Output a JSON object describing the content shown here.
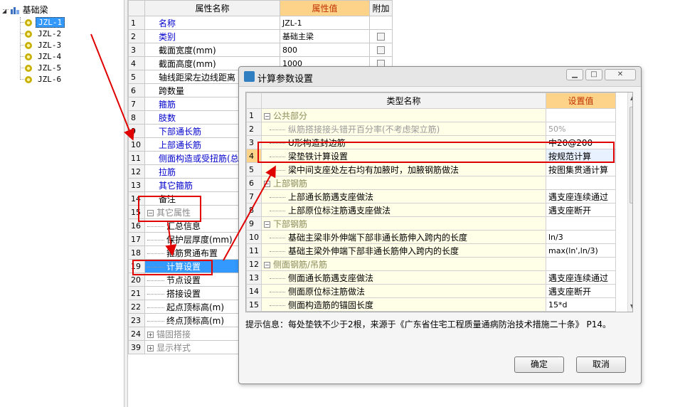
{
  "tree": {
    "root_label": "基础梁",
    "items": [
      {
        "label": "JZL-1",
        "selected": true
      },
      {
        "label": "JZL-2",
        "selected": false
      },
      {
        "label": "JZL-3",
        "selected": false
      },
      {
        "label": "JZL-4",
        "selected": false
      },
      {
        "label": "JZL-5",
        "selected": false
      },
      {
        "label": "JZL-6",
        "selected": false
      }
    ]
  },
  "props": {
    "headers": {
      "name": "属性名称",
      "value": "属性值",
      "extra": "附加"
    },
    "rows": [
      {
        "num": "1",
        "name": "名称",
        "value": "JZL-1",
        "style": "blue",
        "check": false
      },
      {
        "num": "2",
        "name": "类别",
        "value": "基础主梁",
        "style": "blue",
        "check": true
      },
      {
        "num": "3",
        "name": "截面宽度(mm)",
        "value": "800",
        "style": "",
        "check": true
      },
      {
        "num": "4",
        "name": "截面高度(mm)",
        "value": "1000",
        "style": "",
        "check": true
      },
      {
        "num": "5",
        "name": "轴线距梁左边线距离",
        "value": "",
        "style": "",
        "check": false
      },
      {
        "num": "6",
        "name": "跨数量",
        "value": "",
        "style": "",
        "check": false
      },
      {
        "num": "7",
        "name": "箍筋",
        "value": "",
        "style": "blue",
        "check": false
      },
      {
        "num": "8",
        "name": "肢数",
        "value": "",
        "style": "blue",
        "check": false
      },
      {
        "num": "9",
        "name": "下部通长筋",
        "value": "",
        "style": "blue",
        "check": false
      },
      {
        "num": "10",
        "name": "上部通长筋",
        "value": "",
        "style": "blue",
        "check": false
      },
      {
        "num": "11",
        "name": "侧面构造或受扭筋(总",
        "value": "",
        "style": "blue",
        "check": false
      },
      {
        "num": "12",
        "name": "拉筋",
        "value": "",
        "style": "blue",
        "check": false
      },
      {
        "num": "13",
        "name": "其它箍筋",
        "value": "",
        "style": "blue",
        "check": false
      },
      {
        "num": "14",
        "name": "备注",
        "value": "",
        "style": "",
        "check": false
      },
      {
        "num": "15",
        "name": "其它属性",
        "value": "",
        "style": "gray",
        "group": "−",
        "check": false
      },
      {
        "num": "16",
        "name": "汇总信息",
        "value": "",
        "style": "",
        "child": true,
        "check": false
      },
      {
        "num": "17",
        "name": "保护层厚度(mm)",
        "value": "",
        "style": "",
        "child": true,
        "check": false
      },
      {
        "num": "18",
        "name": "箍筋贯通布置",
        "value": "",
        "style": "",
        "child": true,
        "check": false
      },
      {
        "num": "19",
        "name": "计算设置",
        "value": "",
        "style": "",
        "child": true,
        "selected": true,
        "check": false
      },
      {
        "num": "20",
        "name": "节点设置",
        "value": "",
        "style": "",
        "child": true,
        "check": false
      },
      {
        "num": "21",
        "name": "搭接设置",
        "value": "",
        "style": "",
        "child": true,
        "check": false
      },
      {
        "num": "22",
        "name": "起点顶标高(m)",
        "value": "",
        "style": "",
        "child": true,
        "check": false
      },
      {
        "num": "23",
        "name": "终点顶标高(m)",
        "value": "",
        "style": "",
        "child": true,
        "check": false
      },
      {
        "num": "24",
        "name": "锚固搭接",
        "value": "",
        "style": "gray",
        "group": "+",
        "check": false
      },
      {
        "num": "39",
        "name": "显示样式",
        "value": "",
        "style": "gray",
        "group": "+",
        "check": false
      }
    ]
  },
  "dialog": {
    "title": "计算参数设置",
    "headers": {
      "name": "类型名称",
      "value": "设置值"
    },
    "rows": [
      {
        "num": "1",
        "name": "公共部分",
        "value": "",
        "kind": "group"
      },
      {
        "num": "2",
        "name": "纵筋搭接接头错开百分率(不考虑架立筋)",
        "value": "50%",
        "kind": "dim"
      },
      {
        "num": "3",
        "name": "U形构造封边筋",
        "value": "中20@200",
        "kind": "item"
      },
      {
        "num": "4",
        "name": "梁垫铁计算设置",
        "value": "按规范计算",
        "kind": "item",
        "selected": true
      },
      {
        "num": "5",
        "name": "梁中间支座处左右均有加腋时，加腋钢筋做法",
        "value": "按图集贯通计算",
        "kind": "item"
      },
      {
        "num": "6",
        "name": "上部钢筋",
        "value": "",
        "kind": "group"
      },
      {
        "num": "7",
        "name": "上部通长筋遇支座做法",
        "value": "遇支座连续通过",
        "kind": "item"
      },
      {
        "num": "8",
        "name": "上部原位标注筋遇支座做法",
        "value": "遇支座断开",
        "kind": "item"
      },
      {
        "num": "9",
        "name": "下部钢筋",
        "value": "",
        "kind": "group"
      },
      {
        "num": "10",
        "name": "基础主梁非外伸端下部非通长筋伸入跨内的长度",
        "value": "ln/3",
        "kind": "item"
      },
      {
        "num": "11",
        "name": "基础主梁外伸端下部非通长筋伸入跨内的长度",
        "value": "max(ln',ln/3)",
        "kind": "item"
      },
      {
        "num": "12",
        "name": "侧面钢筋/吊筋",
        "value": "",
        "kind": "group"
      },
      {
        "num": "13",
        "name": "侧面通长筋遇支座做法",
        "value": "遇支座连续通过",
        "kind": "item"
      },
      {
        "num": "14",
        "name": "侧面原位标注筋做法",
        "value": "遇支座断开",
        "kind": "item"
      },
      {
        "num": "15",
        "name": "侧面构造筋的锚固长度",
        "value": "15*d",
        "kind": "item"
      }
    ],
    "info": "提示信息：每处垫铁不少于2根，来源于《广东省住宅工程质量通病防治技术措施二十条》 P14。",
    "ok_label": "确定",
    "cancel_label": "取消"
  },
  "colors": {
    "accent": "#e00000",
    "selected": "#3399ff",
    "header_value_bg": "#fdd38a"
  }
}
